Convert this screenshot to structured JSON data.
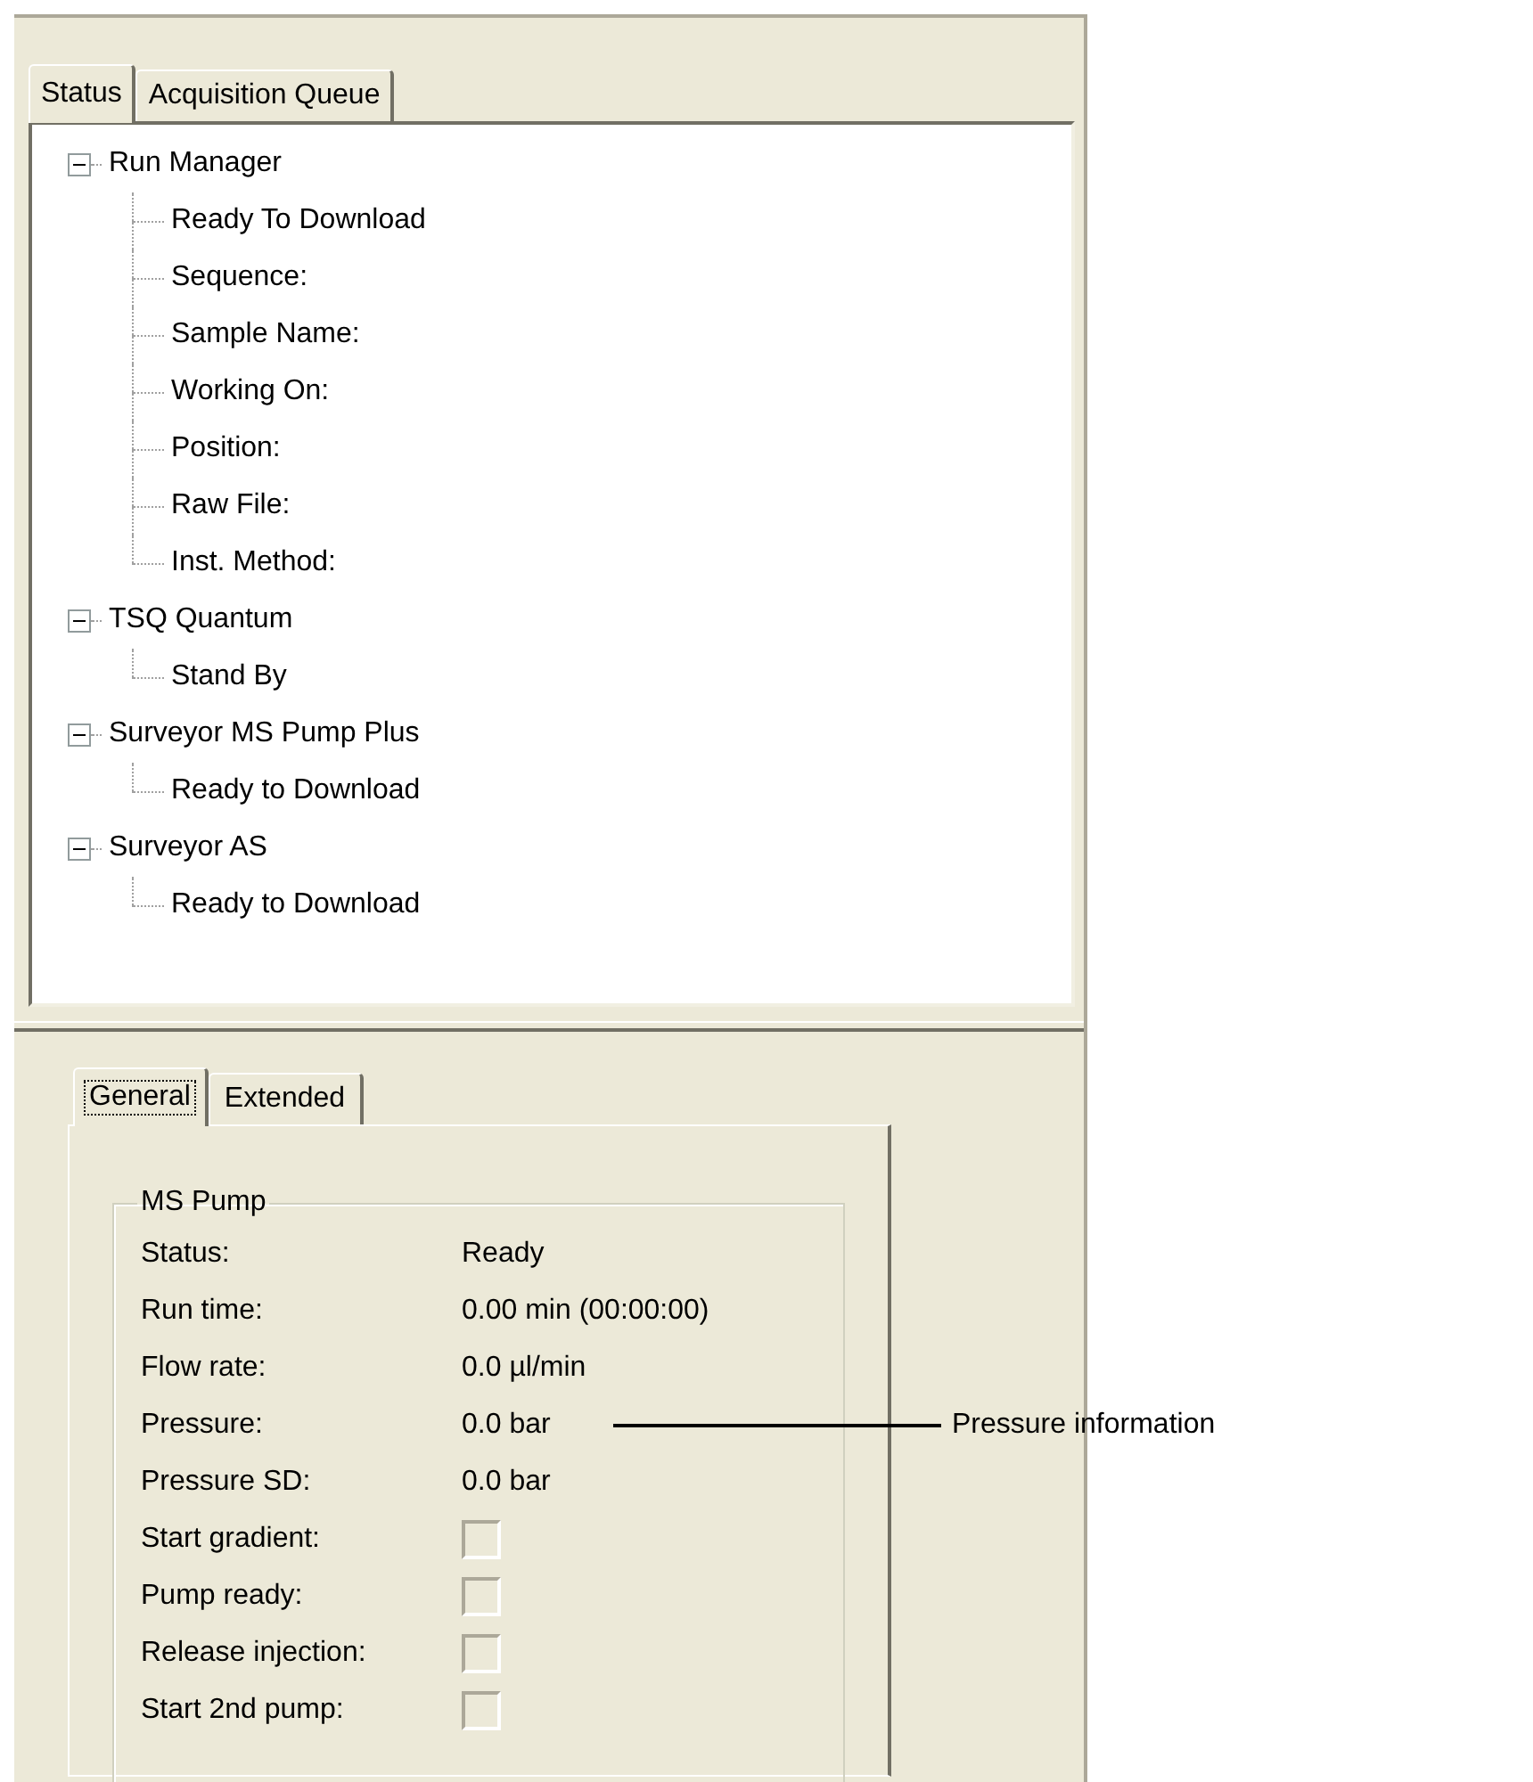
{
  "tabs": [
    {
      "label": "Status",
      "selected": true
    },
    {
      "label": "Acquisition Queue",
      "selected": false
    }
  ],
  "tree": [
    {
      "label": "Run Manager",
      "expanded": true,
      "children": [
        {
          "label": "Ready To Download"
        },
        {
          "label": "Sequence:"
        },
        {
          "label": "Sample Name:"
        },
        {
          "label": "Working On:"
        },
        {
          "label": "Position:"
        },
        {
          "label": "Raw File:"
        },
        {
          "label": "Inst. Method:"
        }
      ]
    },
    {
      "label": "TSQ Quantum",
      "expanded": true,
      "children": [
        {
          "label": "Stand By"
        }
      ]
    },
    {
      "label": "Surveyor MS Pump Plus",
      "expanded": true,
      "children": [
        {
          "label": "Ready to Download"
        }
      ]
    },
    {
      "label": "Surveyor AS",
      "expanded": true,
      "children": [
        {
          "label": "Ready to Download"
        }
      ]
    }
  ],
  "detail_tabs": [
    {
      "label": "General",
      "selected": true
    },
    {
      "label": "Extended",
      "selected": false
    }
  ],
  "group": {
    "title": "MS Pump",
    "rows": [
      {
        "kind": "text",
        "label": "Status:",
        "value": "Ready"
      },
      {
        "kind": "text",
        "label": "Run time:",
        "value": "0.00 min (00:00:00)"
      },
      {
        "kind": "text",
        "label": "Flow rate:",
        "value": "0.0 µl/min"
      },
      {
        "kind": "text",
        "label": "Pressure:",
        "value": "0.0 bar",
        "callout": "Pressure information"
      },
      {
        "kind": "text",
        "label": "Pressure SD:",
        "value": "0.0 bar"
      },
      {
        "kind": "checkbox",
        "label": "Start gradient:",
        "checked": false
      },
      {
        "kind": "checkbox",
        "label": "Pump ready:",
        "checked": false
      },
      {
        "kind": "checkbox",
        "label": "Release injection:",
        "checked": false
      },
      {
        "kind": "checkbox",
        "label": "Start 2nd pump:",
        "checked": false
      }
    ]
  }
}
